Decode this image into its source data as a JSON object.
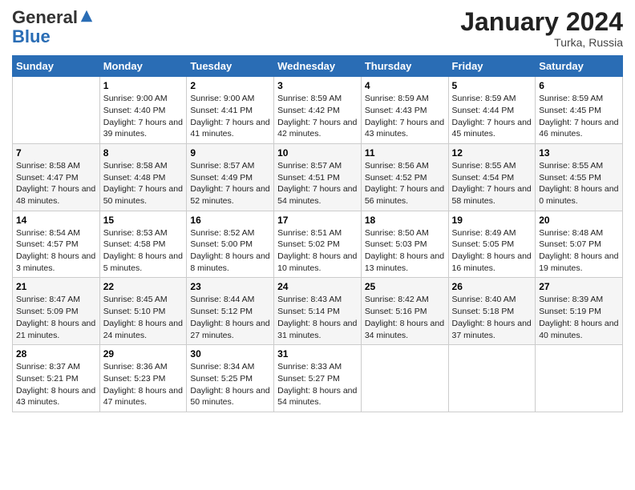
{
  "header": {
    "logo_general": "General",
    "logo_blue": "Blue",
    "month_title": "January 2024",
    "location": "Turka, Russia"
  },
  "columns": [
    "Sunday",
    "Monday",
    "Tuesday",
    "Wednesday",
    "Thursday",
    "Friday",
    "Saturday"
  ],
  "weeks": [
    [
      {
        "day": "",
        "sunrise": "",
        "sunset": "",
        "daylight": ""
      },
      {
        "day": "1",
        "sunrise": "Sunrise: 9:00 AM",
        "sunset": "Sunset: 4:40 PM",
        "daylight": "Daylight: 7 hours and 39 minutes."
      },
      {
        "day": "2",
        "sunrise": "Sunrise: 9:00 AM",
        "sunset": "Sunset: 4:41 PM",
        "daylight": "Daylight: 7 hours and 41 minutes."
      },
      {
        "day": "3",
        "sunrise": "Sunrise: 8:59 AM",
        "sunset": "Sunset: 4:42 PM",
        "daylight": "Daylight: 7 hours and 42 minutes."
      },
      {
        "day": "4",
        "sunrise": "Sunrise: 8:59 AM",
        "sunset": "Sunset: 4:43 PM",
        "daylight": "Daylight: 7 hours and 43 minutes."
      },
      {
        "day": "5",
        "sunrise": "Sunrise: 8:59 AM",
        "sunset": "Sunset: 4:44 PM",
        "daylight": "Daylight: 7 hours and 45 minutes."
      },
      {
        "day": "6",
        "sunrise": "Sunrise: 8:59 AM",
        "sunset": "Sunset: 4:45 PM",
        "daylight": "Daylight: 7 hours and 46 minutes."
      }
    ],
    [
      {
        "day": "7",
        "sunrise": "Sunrise: 8:58 AM",
        "sunset": "Sunset: 4:47 PM",
        "daylight": "Daylight: 7 hours and 48 minutes."
      },
      {
        "day": "8",
        "sunrise": "Sunrise: 8:58 AM",
        "sunset": "Sunset: 4:48 PM",
        "daylight": "Daylight: 7 hours and 50 minutes."
      },
      {
        "day": "9",
        "sunrise": "Sunrise: 8:57 AM",
        "sunset": "Sunset: 4:49 PM",
        "daylight": "Daylight: 7 hours and 52 minutes."
      },
      {
        "day": "10",
        "sunrise": "Sunrise: 8:57 AM",
        "sunset": "Sunset: 4:51 PM",
        "daylight": "Daylight: 7 hours and 54 minutes."
      },
      {
        "day": "11",
        "sunrise": "Sunrise: 8:56 AM",
        "sunset": "Sunset: 4:52 PM",
        "daylight": "Daylight: 7 hours and 56 minutes."
      },
      {
        "day": "12",
        "sunrise": "Sunrise: 8:55 AM",
        "sunset": "Sunset: 4:54 PM",
        "daylight": "Daylight: 7 hours and 58 minutes."
      },
      {
        "day": "13",
        "sunrise": "Sunrise: 8:55 AM",
        "sunset": "Sunset: 4:55 PM",
        "daylight": "Daylight: 8 hours and 0 minutes."
      }
    ],
    [
      {
        "day": "14",
        "sunrise": "Sunrise: 8:54 AM",
        "sunset": "Sunset: 4:57 PM",
        "daylight": "Daylight: 8 hours and 3 minutes."
      },
      {
        "day": "15",
        "sunrise": "Sunrise: 8:53 AM",
        "sunset": "Sunset: 4:58 PM",
        "daylight": "Daylight: 8 hours and 5 minutes."
      },
      {
        "day": "16",
        "sunrise": "Sunrise: 8:52 AM",
        "sunset": "Sunset: 5:00 PM",
        "daylight": "Daylight: 8 hours and 8 minutes."
      },
      {
        "day": "17",
        "sunrise": "Sunrise: 8:51 AM",
        "sunset": "Sunset: 5:02 PM",
        "daylight": "Daylight: 8 hours and 10 minutes."
      },
      {
        "day": "18",
        "sunrise": "Sunrise: 8:50 AM",
        "sunset": "Sunset: 5:03 PM",
        "daylight": "Daylight: 8 hours and 13 minutes."
      },
      {
        "day": "19",
        "sunrise": "Sunrise: 8:49 AM",
        "sunset": "Sunset: 5:05 PM",
        "daylight": "Daylight: 8 hours and 16 minutes."
      },
      {
        "day": "20",
        "sunrise": "Sunrise: 8:48 AM",
        "sunset": "Sunset: 5:07 PM",
        "daylight": "Daylight: 8 hours and 19 minutes."
      }
    ],
    [
      {
        "day": "21",
        "sunrise": "Sunrise: 8:47 AM",
        "sunset": "Sunset: 5:09 PM",
        "daylight": "Daylight: 8 hours and 21 minutes."
      },
      {
        "day": "22",
        "sunrise": "Sunrise: 8:45 AM",
        "sunset": "Sunset: 5:10 PM",
        "daylight": "Daylight: 8 hours and 24 minutes."
      },
      {
        "day": "23",
        "sunrise": "Sunrise: 8:44 AM",
        "sunset": "Sunset: 5:12 PM",
        "daylight": "Daylight: 8 hours and 27 minutes."
      },
      {
        "day": "24",
        "sunrise": "Sunrise: 8:43 AM",
        "sunset": "Sunset: 5:14 PM",
        "daylight": "Daylight: 8 hours and 31 minutes."
      },
      {
        "day": "25",
        "sunrise": "Sunrise: 8:42 AM",
        "sunset": "Sunset: 5:16 PM",
        "daylight": "Daylight: 8 hours and 34 minutes."
      },
      {
        "day": "26",
        "sunrise": "Sunrise: 8:40 AM",
        "sunset": "Sunset: 5:18 PM",
        "daylight": "Daylight: 8 hours and 37 minutes."
      },
      {
        "day": "27",
        "sunrise": "Sunrise: 8:39 AM",
        "sunset": "Sunset: 5:19 PM",
        "daylight": "Daylight: 8 hours and 40 minutes."
      }
    ],
    [
      {
        "day": "28",
        "sunrise": "Sunrise: 8:37 AM",
        "sunset": "Sunset: 5:21 PM",
        "daylight": "Daylight: 8 hours and 43 minutes."
      },
      {
        "day": "29",
        "sunrise": "Sunrise: 8:36 AM",
        "sunset": "Sunset: 5:23 PM",
        "daylight": "Daylight: 8 hours and 47 minutes."
      },
      {
        "day": "30",
        "sunrise": "Sunrise: 8:34 AM",
        "sunset": "Sunset: 5:25 PM",
        "daylight": "Daylight: 8 hours and 50 minutes."
      },
      {
        "day": "31",
        "sunrise": "Sunrise: 8:33 AM",
        "sunset": "Sunset: 5:27 PM",
        "daylight": "Daylight: 8 hours and 54 minutes."
      },
      {
        "day": "",
        "sunrise": "",
        "sunset": "",
        "daylight": ""
      },
      {
        "day": "",
        "sunrise": "",
        "sunset": "",
        "daylight": ""
      },
      {
        "day": "",
        "sunrise": "",
        "sunset": "",
        "daylight": ""
      }
    ]
  ]
}
